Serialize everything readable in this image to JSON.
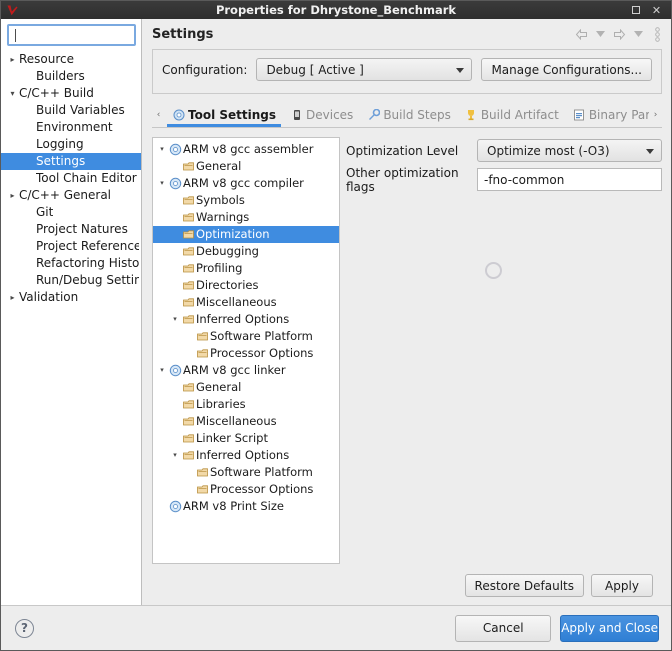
{
  "window": {
    "title": "Properties for Dhrystone_Benchmark",
    "logo_icon": "eclipse-logo-icon",
    "maximize_label": "□",
    "close_label": "✕"
  },
  "filter": {
    "value": "",
    "placeholder": ""
  },
  "sidebar": {
    "items": [
      {
        "label": "Resource",
        "arrow": "▸",
        "level": 0,
        "selected": false
      },
      {
        "label": "Builders",
        "arrow": "",
        "level": 1,
        "selected": false
      },
      {
        "label": "C/C++ Build",
        "arrow": "▾",
        "level": 0,
        "selected": false
      },
      {
        "label": "Build Variables",
        "arrow": "",
        "level": 1,
        "selected": false
      },
      {
        "label": "Environment",
        "arrow": "",
        "level": 1,
        "selected": false
      },
      {
        "label": "Logging",
        "arrow": "",
        "level": 1,
        "selected": false
      },
      {
        "label": "Settings",
        "arrow": "",
        "level": 1,
        "selected": true
      },
      {
        "label": "Tool Chain Editor",
        "arrow": "",
        "level": 1,
        "selected": false
      },
      {
        "label": "C/C++ General",
        "arrow": "▸",
        "level": 0,
        "selected": false
      },
      {
        "label": "Git",
        "arrow": "",
        "level": 1,
        "selected": false
      },
      {
        "label": "Project Natures",
        "arrow": "",
        "level": 1,
        "selected": false
      },
      {
        "label": "Project References",
        "arrow": "",
        "level": 1,
        "selected": false
      },
      {
        "label": "Refactoring History",
        "arrow": "",
        "level": 1,
        "selected": false
      },
      {
        "label": "Run/Debug Settings",
        "arrow": "",
        "level": 1,
        "selected": false
      },
      {
        "label": "Validation",
        "arrow": "▸",
        "level": 0,
        "selected": false
      }
    ]
  },
  "page": {
    "title": "Settings",
    "header_tools": [
      "back-arrow-icon",
      "back-dropdown-icon",
      "forward-arrow-icon",
      "forward-dropdown-icon",
      "view-menu-icon"
    ]
  },
  "configuration": {
    "label": "Configuration:",
    "selected": "Debug  [ Active ]",
    "manage_label": "Manage Configurations..."
  },
  "tabs": {
    "scroll_left": "‹",
    "scroll_right": "›",
    "items": [
      {
        "label": "Tool Settings",
        "icon": "tool-settings-icon",
        "active": true
      },
      {
        "label": "Devices",
        "icon": "devices-icon",
        "active": false
      },
      {
        "label": "Build Steps",
        "icon": "build-steps-icon",
        "active": false
      },
      {
        "label": "Build Artifact",
        "icon": "build-artifact-icon",
        "active": false
      },
      {
        "label": "Binary Parsers",
        "icon": "binary-parsers-icon",
        "active": false
      }
    ]
  },
  "tool_tree": {
    "nodes": [
      {
        "label": "ARM v8 gcc assembler",
        "arrow": "▾",
        "icon": "tool-icon",
        "level": 0,
        "selected": false
      },
      {
        "label": "General",
        "arrow": "",
        "icon": "page-icon",
        "level": 1,
        "selected": false
      },
      {
        "label": "ARM v8 gcc compiler",
        "arrow": "▾",
        "icon": "tool-icon",
        "level": 0,
        "selected": false
      },
      {
        "label": "Symbols",
        "arrow": "",
        "icon": "page-icon",
        "level": 1,
        "selected": false
      },
      {
        "label": "Warnings",
        "arrow": "",
        "icon": "page-icon",
        "level": 1,
        "selected": false
      },
      {
        "label": "Optimization",
        "arrow": "",
        "icon": "page-icon",
        "level": 1,
        "selected": true
      },
      {
        "label": "Debugging",
        "arrow": "",
        "icon": "page-icon",
        "level": 1,
        "selected": false
      },
      {
        "label": "Profiling",
        "arrow": "",
        "icon": "page-icon",
        "level": 1,
        "selected": false
      },
      {
        "label": "Directories",
        "arrow": "",
        "icon": "page-icon",
        "level": 1,
        "selected": false
      },
      {
        "label": "Miscellaneous",
        "arrow": "",
        "icon": "page-icon",
        "level": 1,
        "selected": false
      },
      {
        "label": "Inferred Options",
        "arrow": "▾",
        "icon": "page-icon",
        "level": 1,
        "selected": false
      },
      {
        "label": "Software Platform",
        "arrow": "",
        "icon": "page-icon",
        "level": 2,
        "selected": false
      },
      {
        "label": "Processor Options",
        "arrow": "",
        "icon": "page-icon",
        "level": 2,
        "selected": false
      },
      {
        "label": "ARM v8 gcc linker",
        "arrow": "▾",
        "icon": "tool-icon",
        "level": 0,
        "selected": false
      },
      {
        "label": "General",
        "arrow": "",
        "icon": "page-icon",
        "level": 1,
        "selected": false
      },
      {
        "label": "Libraries",
        "arrow": "",
        "icon": "page-icon",
        "level": 1,
        "selected": false
      },
      {
        "label": "Miscellaneous",
        "arrow": "",
        "icon": "page-icon",
        "level": 1,
        "selected": false
      },
      {
        "label": "Linker Script",
        "arrow": "",
        "icon": "page-icon",
        "level": 1,
        "selected": false
      },
      {
        "label": "Inferred Options",
        "arrow": "▾",
        "icon": "page-icon",
        "level": 1,
        "selected": false
      },
      {
        "label": "Software Platform",
        "arrow": "",
        "icon": "page-icon",
        "level": 2,
        "selected": false
      },
      {
        "label": "Processor Options",
        "arrow": "",
        "icon": "page-icon",
        "level": 2,
        "selected": false
      },
      {
        "label": "ARM v8 Print Size",
        "arrow": "",
        "icon": "tool-icon",
        "level": 0,
        "selected": false
      }
    ]
  },
  "settings_form": {
    "optimization_level_label": "Optimization Level",
    "optimization_level_value": "Optimize most (-O3)",
    "other_flags_label": "Other optimization flags",
    "other_flags_value": "-fno-common",
    "busy_indicator": "loading-spinner-icon"
  },
  "actions": {
    "restore_defaults": "Restore Defaults",
    "apply": "Apply",
    "cancel": "Cancel",
    "apply_and_close": "Apply and Close",
    "help_icon_label": "?"
  },
  "colors": {
    "selection_blue": "#3f8ce0",
    "primary_button": "#2f7fd4",
    "window_chrome": "#2e2e2e",
    "surface": "#ededed"
  }
}
